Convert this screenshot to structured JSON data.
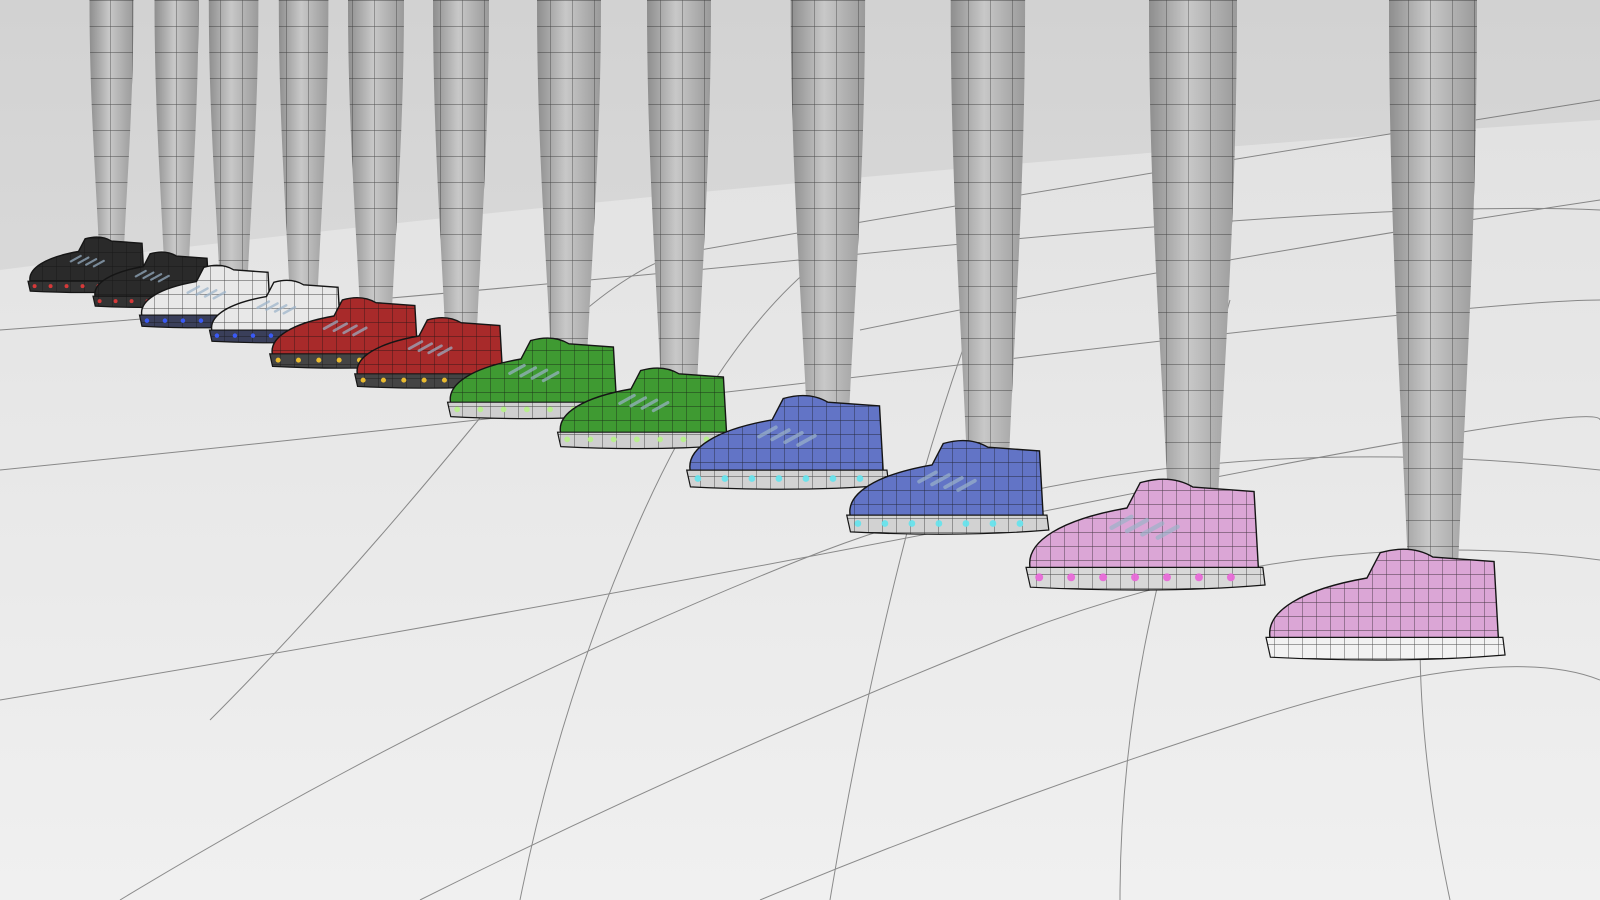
{
  "scene": {
    "background_color": "#dcdcdc",
    "floor_color": "#ebebeb",
    "leg_color": "#b9b9b9",
    "wire_color": "#1e1e1e",
    "sneaker_pairs": [
      {
        "name": "black",
        "upper_color": "#2a2a2a",
        "sole_color": "#333333",
        "led_color": "#e03a3a"
      },
      {
        "name": "white",
        "upper_color": "#e8e8e8",
        "sole_color": "#3a3f5a",
        "led_color": "#3a5cff"
      },
      {
        "name": "red",
        "upper_color": "#a82a2a",
        "sole_color": "#444444",
        "led_color": "#f2c12e"
      },
      {
        "name": "green",
        "upper_color": "#3f9a32",
        "sole_color": "#cfcfcf",
        "led_color": "#b6f08a"
      },
      {
        "name": "blue",
        "upper_color": "#6274c6",
        "sole_color": "#d2d2d2",
        "led_color": "#67e3ec"
      },
      {
        "name": "pink",
        "upper_color": "#dba6d6",
        "sole_color": "#d8d8d8",
        "led_color": "#e86ad8"
      }
    ],
    "unfinished_shoe": {
      "name": "wireframe-only",
      "upper_color": "#efe9f0"
    }
  }
}
